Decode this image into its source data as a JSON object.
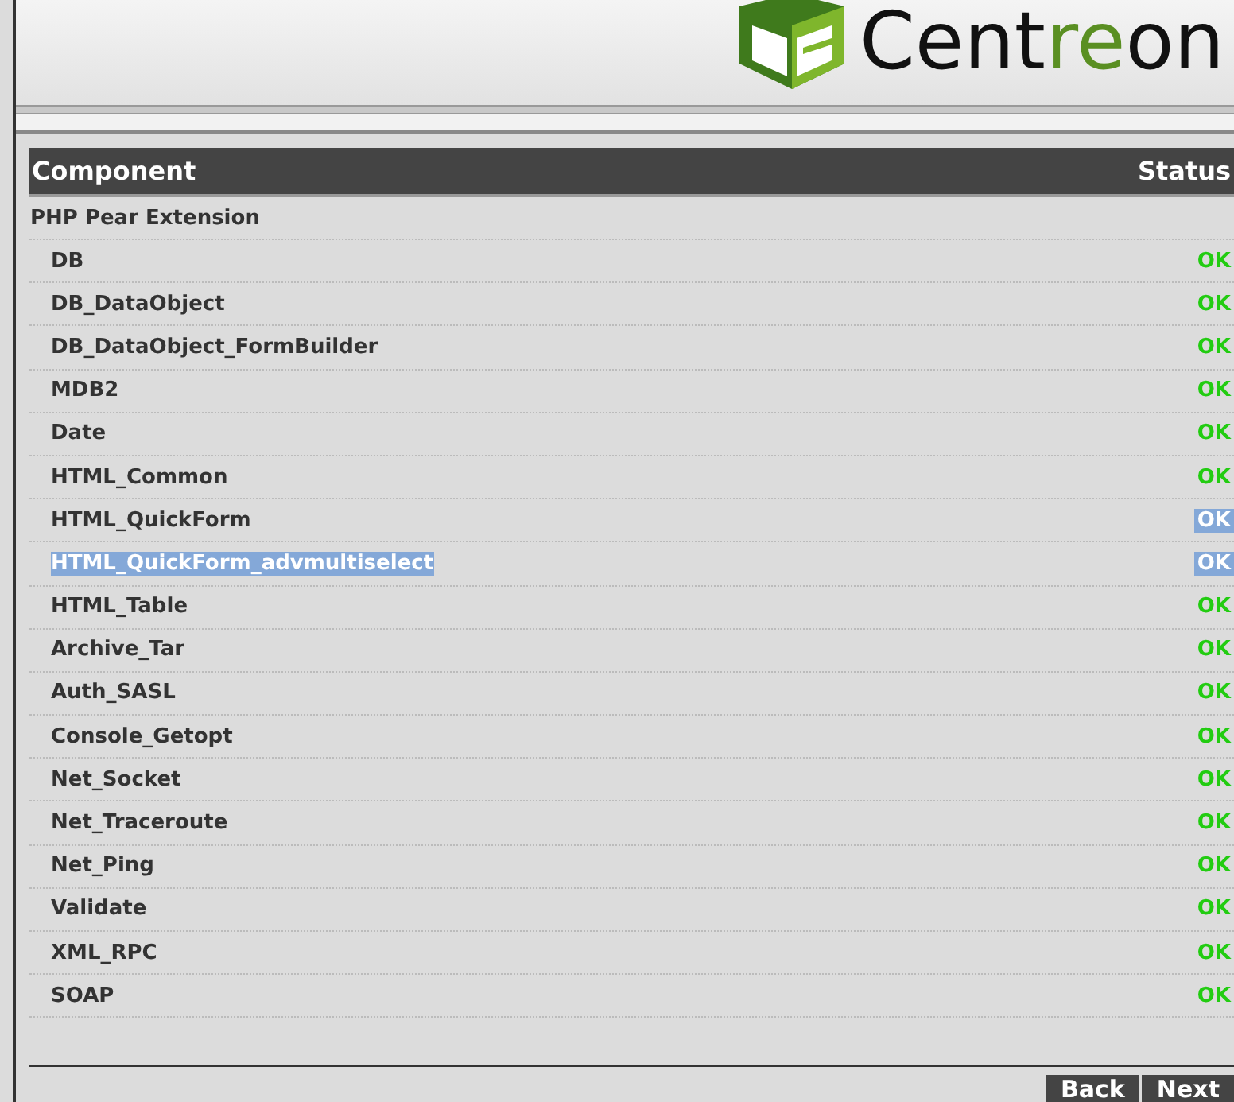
{
  "logo": {
    "parts": [
      {
        "text": "Cent",
        "accent": false
      },
      {
        "text": "re",
        "accent": true
      },
      {
        "text": "on",
        "accent": false
      }
    ]
  },
  "table": {
    "columns": [
      "Component",
      "Status"
    ],
    "section": "PHP Pear Extension",
    "rows": [
      {
        "name": "DB",
        "status": "OK",
        "name_highlighted": false,
        "status_highlighted": false
      },
      {
        "name": "DB_DataObject",
        "status": "OK",
        "name_highlighted": false,
        "status_highlighted": false
      },
      {
        "name": "DB_DataObject_FormBuilder",
        "status": "OK",
        "name_highlighted": false,
        "status_highlighted": false
      },
      {
        "name": "MDB2",
        "status": "OK",
        "name_highlighted": false,
        "status_highlighted": false
      },
      {
        "name": "Date",
        "status": "OK",
        "name_highlighted": false,
        "status_highlighted": false
      },
      {
        "name": "HTML_Common",
        "status": "OK",
        "name_highlighted": false,
        "status_highlighted": false
      },
      {
        "name": "HTML_QuickForm",
        "status": "OK",
        "name_highlighted": false,
        "status_highlighted": true
      },
      {
        "name": "HTML_QuickForm_advmultiselect",
        "status": "OK",
        "name_highlighted": true,
        "status_highlighted": true
      },
      {
        "name": "HTML_Table",
        "status": "OK",
        "name_highlighted": false,
        "status_highlighted": false
      },
      {
        "name": "Archive_Tar",
        "status": "OK",
        "name_highlighted": false,
        "status_highlighted": false
      },
      {
        "name": "Auth_SASL",
        "status": "OK",
        "name_highlighted": false,
        "status_highlighted": false
      },
      {
        "name": "Console_Getopt",
        "status": "OK",
        "name_highlighted": false,
        "status_highlighted": false
      },
      {
        "name": "Net_Socket",
        "status": "OK",
        "name_highlighted": false,
        "status_highlighted": false
      },
      {
        "name": "Net_Traceroute",
        "status": "OK",
        "name_highlighted": false,
        "status_highlighted": false
      },
      {
        "name": "Net_Ping",
        "status": "OK",
        "name_highlighted": false,
        "status_highlighted": false
      },
      {
        "name": "Validate",
        "status": "OK",
        "name_highlighted": false,
        "status_highlighted": false
      },
      {
        "name": "XML_RPC",
        "status": "OK",
        "name_highlighted": false,
        "status_highlighted": false
      },
      {
        "name": "SOAP",
        "status": "OK",
        "name_highlighted": false,
        "status_highlighted": false
      }
    ]
  },
  "buttons": [
    "Back",
    "Next"
  ]
}
